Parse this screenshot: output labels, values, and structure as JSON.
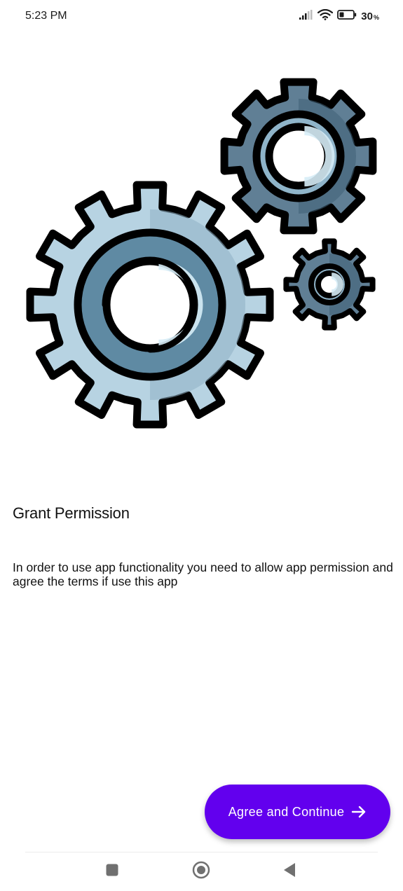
{
  "status_bar": {
    "time": "5:23 PM",
    "battery_level": "30",
    "battery_suffix": "%",
    "icons": [
      "signal-icon",
      "wifi-icon",
      "battery-icon"
    ]
  },
  "illustration": {
    "icon": "gears-icon"
  },
  "content": {
    "title": "Grant Permission",
    "description": "In order to use app functionality you need to allow app permission and agree the terms if use this app"
  },
  "actions": {
    "continue_label": "Agree and Continue",
    "continue_icon": "arrow-right-icon",
    "accent_color": "#6200EE"
  },
  "navigation": {
    "buttons": [
      "recent-apps-button",
      "home-button",
      "back-button"
    ]
  }
}
